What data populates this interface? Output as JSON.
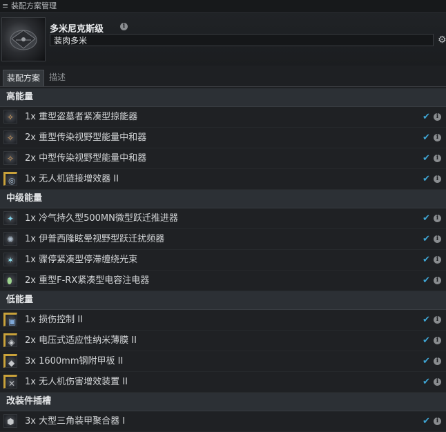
{
  "window": {
    "title": "装配方案管理",
    "menu_icon": "hamburger-icon"
  },
  "ship": {
    "name": "多米尼克斯级",
    "fitting_name": "装肉多米"
  },
  "tabs": [
    {
      "label": "装配方案",
      "active": true
    },
    {
      "label": "描述",
      "active": false
    }
  ],
  "sections": [
    {
      "title": "高能量",
      "items": [
        {
          "text": "1x 重型盗墓者紧凑型掠能器",
          "icon": "energy-neutralizer-icon",
          "tech2": false
        },
        {
          "text": "2x 重型传染视野型能量中和器",
          "icon": "energy-neutralizer-icon",
          "tech2": false
        },
        {
          "text": "2x 中型传染视野型能量中和器",
          "icon": "energy-neutralizer-icon",
          "tech2": false
        },
        {
          "text": "1x 无人机链接增效器 II",
          "icon": "drone-link-icon",
          "tech2": true
        }
      ]
    },
    {
      "title": "中级能量",
      "items": [
        {
          "text": "1x 冷气持久型500MN微型跃迁推进器",
          "icon": "propulsion-icon",
          "tech2": false
        },
        {
          "text": "1x 伊普西隆眩晕视野型跃迁扰频器",
          "icon": "warp-scrambler-icon",
          "tech2": false
        },
        {
          "text": "1x 骤停紧凑型停滞缠绕光束",
          "icon": "stasis-web-icon",
          "tech2": false
        },
        {
          "text": "2x 重型F-RX紧凑型电容注电器",
          "icon": "cap-booster-icon",
          "tech2": false
        }
      ]
    },
    {
      "title": "低能量",
      "items": [
        {
          "text": "1x 损伤控制 II",
          "icon": "damage-control-icon",
          "tech2": true
        },
        {
          "text": "2x 电压式适应性纳米薄膜 II",
          "icon": "membrane-icon",
          "tech2": true
        },
        {
          "text": "3x 1600mm钢附甲板 II",
          "icon": "armor-plate-icon",
          "tech2": true
        },
        {
          "text": "1x 无人机伤害增效装置 II",
          "icon": "drone-damage-icon",
          "tech2": true
        }
      ]
    },
    {
      "title": "改装件插槽",
      "items": [
        {
          "text": "3x 大型三角装甲聚合器 I",
          "icon": "rig-icon",
          "tech2": false
        }
      ]
    }
  ]
}
